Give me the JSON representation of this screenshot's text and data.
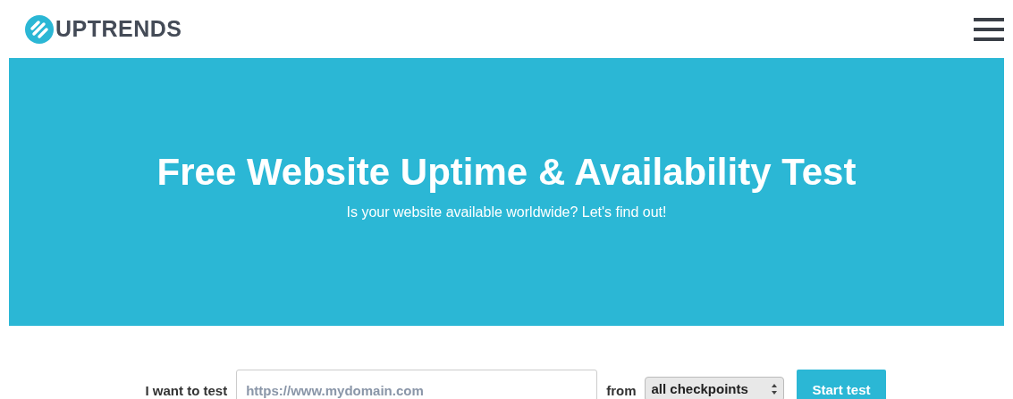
{
  "header": {
    "logo": "UPTRENDS"
  },
  "hero": {
    "title": "Free Website Uptime & Availability Test",
    "subtitle": "Is your website available worldwide? Let's find out!"
  },
  "form": {
    "label": "I want to test",
    "url_field": {
      "placeholder": "https://www.mydomain.com"
    },
    "from_label": "from",
    "checkpoints": {
      "value": "all checkpoints"
    },
    "submit": "Start test"
  }
}
